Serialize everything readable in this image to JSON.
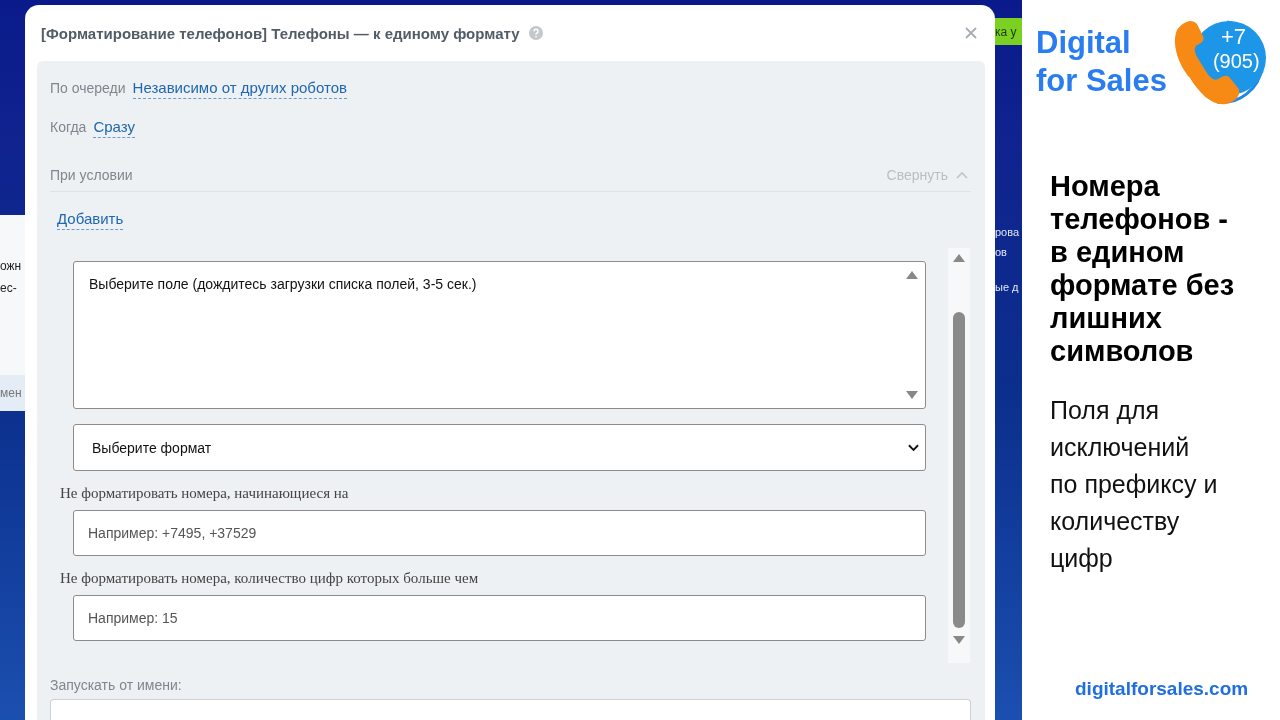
{
  "background": {
    "left_fragments": [
      "ожн",
      "ес-"
    ],
    "left_strip_fragment": "мен",
    "button_fragment": "ка у",
    "right_fragments": [
      "рова",
      "ов",
      "ые д"
    ]
  },
  "dialog": {
    "title": "[Форматирование телефонов] Телефоны — к единому формату",
    "rows": [
      {
        "label": "По очереди",
        "value": "Независимо от других роботов"
      },
      {
        "label": "Когда",
        "value": "Сразу"
      }
    ],
    "condition": {
      "label": "При условии",
      "collapse": "Свернуть",
      "expanded": true,
      "add": "Добавить"
    },
    "form": {
      "field_list": {
        "options": [
          "Выберите поле (дождитесь загрузки списка полей, 3-5 сек.)"
        ]
      },
      "format_select": {
        "value": "Выберите формат"
      },
      "fields": [
        {
          "label": "Не форматировать номера, начинающиеся на",
          "placeholder": "Например: +7495, +37529"
        },
        {
          "label": "Не форматировать номера, количество цифр которых больше чем",
          "placeholder": "Например: 15"
        }
      ]
    },
    "run_as": {
      "label": "Запускать от имени:"
    }
  },
  "promo": {
    "brand": [
      "Digital",
      "for Sales"
    ],
    "logo_number": [
      "+7",
      "(905)"
    ],
    "headline": "Номера телефонов - в едином формате без лишних символов",
    "subtitle": "Поля для исключений по префиксу и количеству цифр",
    "website": "digitalforsales.com"
  }
}
